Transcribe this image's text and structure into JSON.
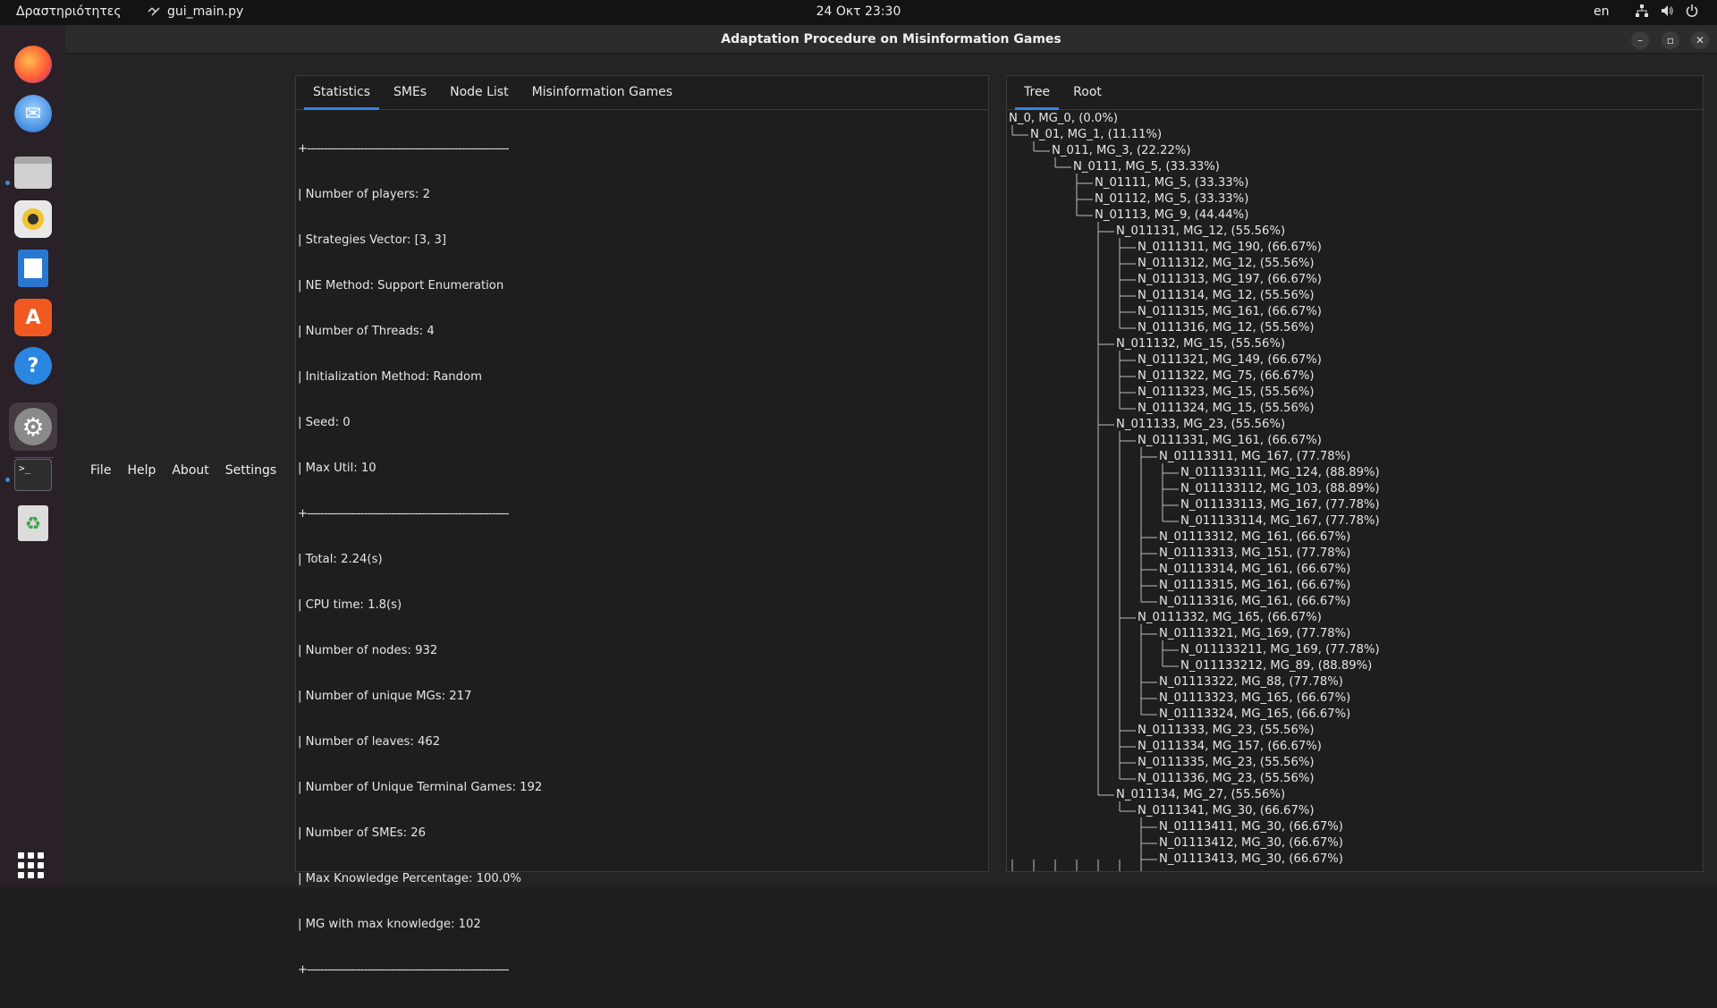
{
  "topbar": {
    "activities": "Δραστηριότητες",
    "app_name": "gui_main.py",
    "clock": "24 Οκτ  23:30",
    "lang": "en",
    "tray_icons": [
      "network-icon",
      "volume-icon",
      "power-icon"
    ]
  },
  "dock": {
    "items": [
      "firefox-icon",
      "thunderbird-icon",
      "files-icon",
      "rhythmbox-icon",
      "writer-icon",
      "software-icon",
      "help-icon",
      "settings-icon",
      "terminal-icon",
      "trash-icon"
    ],
    "apps_grid_icon": "show-apps-icon"
  },
  "window": {
    "title": "Adaptation Procedure on Misinformation Games",
    "controls": {
      "minimize": "–",
      "maximize": "▫",
      "close": "✕"
    }
  },
  "menu": [
    "File",
    "Help",
    "About",
    "Settings"
  ],
  "left_tabs": [
    "Statistics",
    "SMEs",
    "Node List",
    "Misinformation Games"
  ],
  "right_tabs": [
    "Tree",
    "Root"
  ],
  "stats": {
    "separator": "+------------------------------------------------------------",
    "block1": [
      "| Number of players: 2",
      "| Strategies Vector: [3, 3]",
      "| NE Method: Support Enumeration",
      "| Number of Threads: 4",
      "| Initialization Method: Random",
      "| Seed: 0",
      "| Max Util: 10"
    ],
    "block2": [
      "| Total: 2.24(s)",
      "| CPU time: 1.8(s)",
      "| Number of nodes: 932",
      "| Number of unique MGs: 217",
      "| Number of leaves: 462",
      "| Number of Unique Terminal Games: 192",
      "| Number of SMEs: 26",
      "| Max Knowledge Percentage: 100.0%",
      "| MG with max knowledge: 102"
    ]
  },
  "tree": [
    {
      "d": 0,
      "t": "N_0, MG_0, (0.0%)"
    },
    {
      "d": 1,
      "t": "N_01, MG_1, (11.11%)"
    },
    {
      "d": 2,
      "t": "N_011, MG_3, (22.22%)"
    },
    {
      "d": 3,
      "t": "N_0111, MG_5, (33.33%)"
    },
    {
      "d": 4,
      "t": "N_01111, MG_5, (33.33%)"
    },
    {
      "d": 4,
      "t": "N_01112, MG_5, (33.33%)"
    },
    {
      "d": 4,
      "t": "N_01113, MG_9, (44.44%)"
    },
    {
      "d": 5,
      "t": "N_011131, MG_12, (55.56%)"
    },
    {
      "d": 6,
      "t": "N_0111311, MG_190, (66.67%)"
    },
    {
      "d": 6,
      "t": "N_0111312, MG_12, (55.56%)"
    },
    {
      "d": 6,
      "t": "N_0111313, MG_197, (66.67%)"
    },
    {
      "d": 6,
      "t": "N_0111314, MG_12, (55.56%)"
    },
    {
      "d": 6,
      "t": "N_0111315, MG_161, (66.67%)"
    },
    {
      "d": 6,
      "t": "N_0111316, MG_12, (55.56%)"
    },
    {
      "d": 5,
      "t": "N_011132, MG_15, (55.56%)"
    },
    {
      "d": 6,
      "t": "N_0111321, MG_149, (66.67%)"
    },
    {
      "d": 6,
      "t": "N_0111322, MG_75, (66.67%)"
    },
    {
      "d": 6,
      "t": "N_0111323, MG_15, (55.56%)"
    },
    {
      "d": 6,
      "t": "N_0111324, MG_15, (55.56%)"
    },
    {
      "d": 5,
      "t": "N_011133, MG_23, (55.56%)"
    },
    {
      "d": 6,
      "t": "N_0111331, MG_161, (66.67%)"
    },
    {
      "d": 7,
      "t": "N_01113311, MG_167, (77.78%)"
    },
    {
      "d": 8,
      "t": "N_011133111, MG_124, (88.89%)"
    },
    {
      "d": 8,
      "t": "N_011133112, MG_103, (88.89%)"
    },
    {
      "d": 8,
      "t": "N_011133113, MG_167, (77.78%)"
    },
    {
      "d": 8,
      "t": "N_011133114, MG_167, (77.78%)"
    },
    {
      "d": 7,
      "t": "N_01113312, MG_161, (66.67%)"
    },
    {
      "d": 7,
      "t": "N_01113313, MG_151, (77.78%)"
    },
    {
      "d": 7,
      "t": "N_01113314, MG_161, (66.67%)"
    },
    {
      "d": 7,
      "t": "N_01113315, MG_161, (66.67%)"
    },
    {
      "d": 7,
      "t": "N_01113316, MG_161, (66.67%)"
    },
    {
      "d": 6,
      "t": "N_0111332, MG_165, (66.67%)"
    },
    {
      "d": 7,
      "t": "N_01113321, MG_169, (77.78%)"
    },
    {
      "d": 8,
      "t": "N_011133211, MG_169, (77.78%)"
    },
    {
      "d": 8,
      "t": "N_011133212, MG_89, (88.89%)"
    },
    {
      "d": 7,
      "t": "N_01113322, MG_88, (77.78%)"
    },
    {
      "d": 7,
      "t": "N_01113323, MG_165, (66.67%)"
    },
    {
      "d": 7,
      "t": "N_01113324, MG_165, (66.67%)"
    },
    {
      "d": 6,
      "t": "N_0111333, MG_23, (55.56%)"
    },
    {
      "d": 6,
      "t": "N_0111334, MG_157, (66.67%)"
    },
    {
      "d": 6,
      "t": "N_0111335, MG_23, (55.56%)"
    },
    {
      "d": 6,
      "t": "N_0111336, MG_23, (55.56%)"
    },
    {
      "d": 5,
      "t": "N_011134, MG_27, (55.56%)"
    },
    {
      "d": 6,
      "t": "N_0111341, MG_30, (66.67%)"
    },
    {
      "d": 7,
      "t": "N_01113411, MG_30, (66.67%)"
    },
    {
      "d": 7,
      "t": "N_01113412, MG_30, (66.67%)"
    },
    {
      "d": 7,
      "t": "N_01113413, MG_30, (66.67%)"
    }
  ]
}
